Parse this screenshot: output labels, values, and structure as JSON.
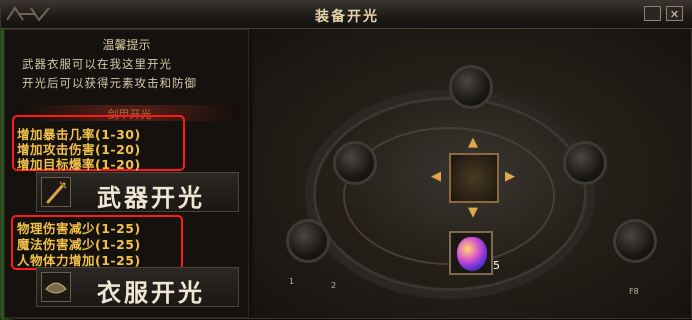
{
  "window": {
    "title": "装备开光",
    "close_glyph": "✕"
  },
  "tips": {
    "title": "温馨提示",
    "lines": [
      "武器衣服可以在我这里开光",
      "开光后可以获得元素攻击和防御"
    ]
  },
  "section": {
    "title": "剑甲开光"
  },
  "weapon": {
    "stats": [
      "增加暴击几率(1-30)",
      "增加攻击伤害(1-20)",
      "增加目标爆率(1-20)"
    ],
    "button_label": "武器开光",
    "icon": "sword-icon"
  },
  "armor": {
    "stats": [
      "物理伤害减少(1-25)",
      "魔法伤害减少(1-25)",
      "人物体力增加(1-25)"
    ],
    "button_label": "衣服开光",
    "icon": "armor-icon"
  },
  "stage": {
    "gem_count": "5",
    "hotkeys": [
      "1",
      "2",
      "F8"
    ]
  },
  "colors": {
    "highlight_box": "#ff1a1a",
    "stat_text": "#f2c14a",
    "arrow": "#e0a848"
  }
}
